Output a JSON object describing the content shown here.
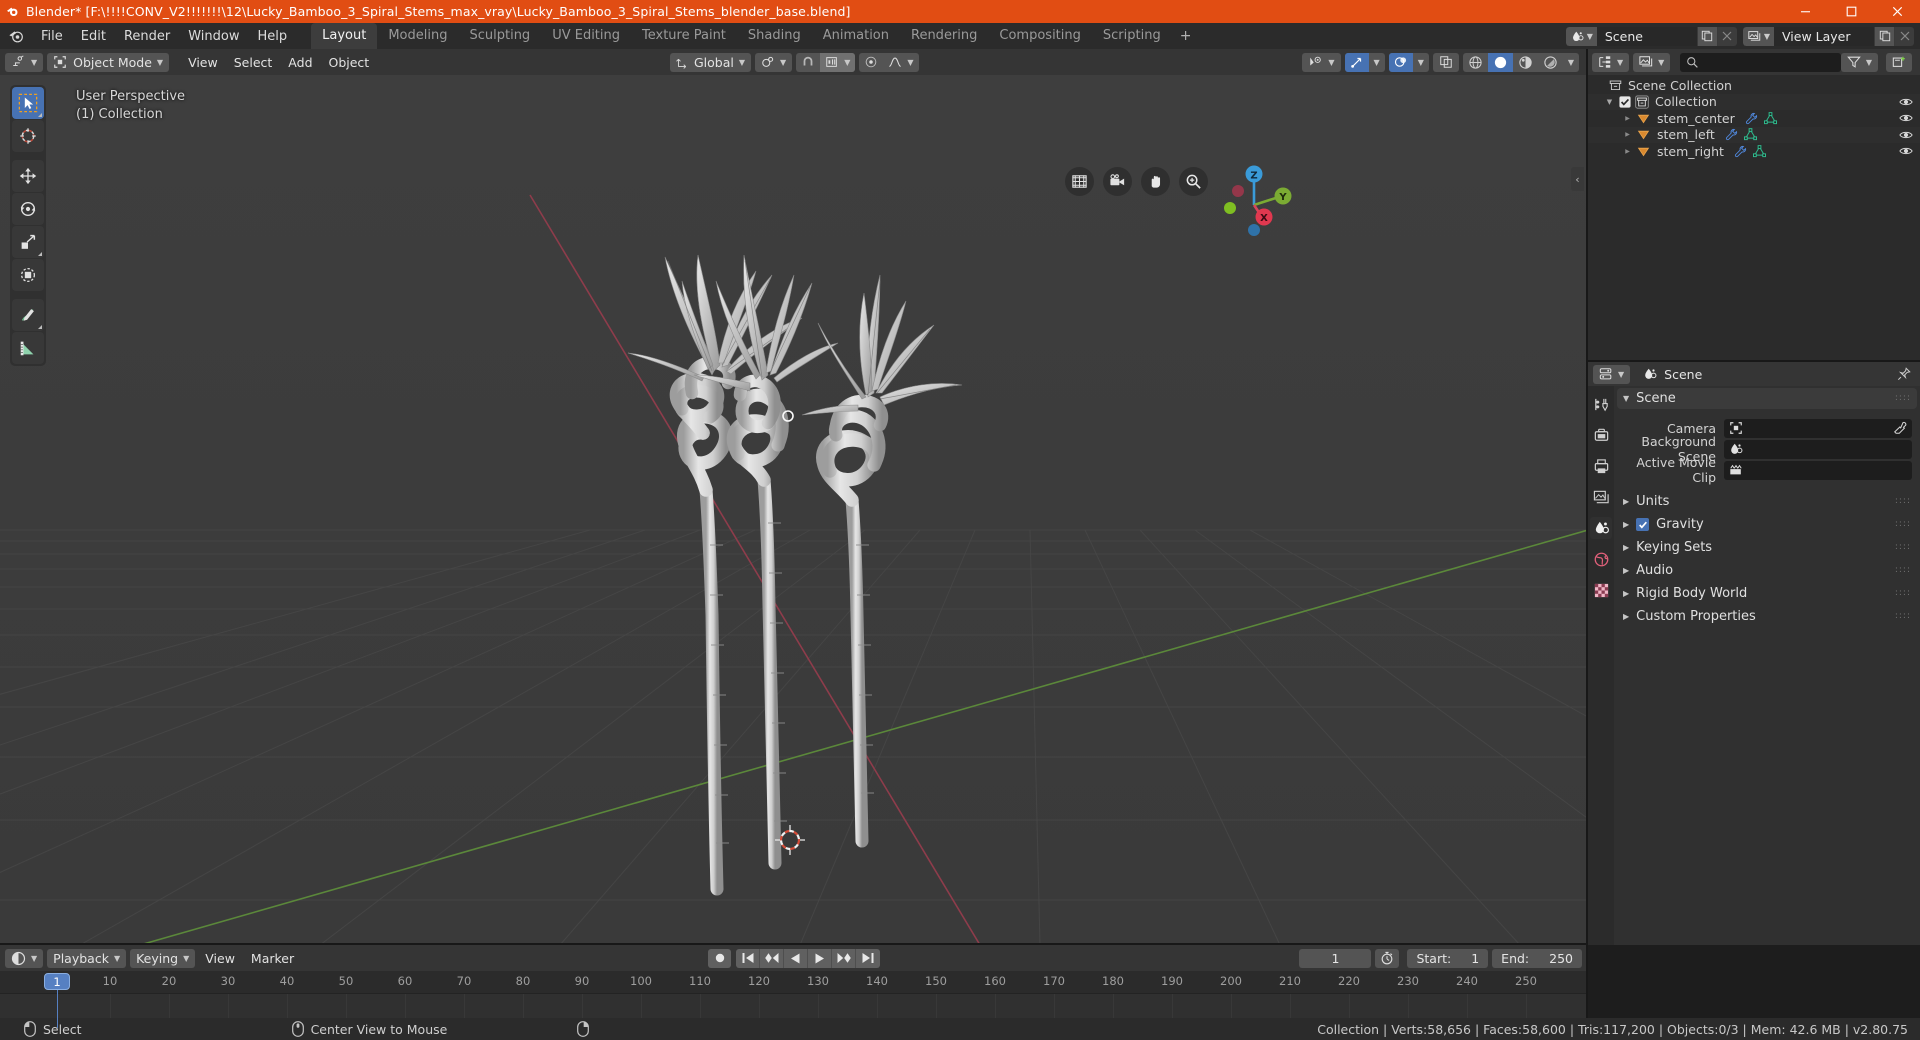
{
  "window": {
    "title": "Blender* [F:\\!!!!CONV_V2!!!!!!!\\12\\Lucky_Bamboo_3_Spiral_Stems_max_vray\\Lucky_Bamboo_3_Spiral_Stems_blender_base.blend]",
    "app_icon": "blender-logo-icon",
    "minimize": "–",
    "maximize": "□",
    "close": "✕",
    "accent_color": "#e14d13"
  },
  "topbar": {
    "menus": [
      "File",
      "Edit",
      "Render",
      "Window",
      "Help"
    ],
    "workspaces": [
      {
        "label": "Layout",
        "active": true
      },
      {
        "label": "Modeling",
        "active": false
      },
      {
        "label": "Sculpting",
        "active": false
      },
      {
        "label": "UV Editing",
        "active": false
      },
      {
        "label": "Texture Paint",
        "active": false
      },
      {
        "label": "Shading",
        "active": false
      },
      {
        "label": "Animation",
        "active": false
      },
      {
        "label": "Rendering",
        "active": false
      },
      {
        "label": "Compositing",
        "active": false
      },
      {
        "label": "Scripting",
        "active": false
      }
    ],
    "add_workspace": "+",
    "scene_name": "Scene",
    "view_layer_name": "View Layer"
  },
  "viewport_header": {
    "editor_type_icon": "editor-type-icon",
    "mode": "Object Mode",
    "menus": [
      "View",
      "Select",
      "Add",
      "Object"
    ],
    "transform_orientation": "Global",
    "pivot_icon": "pivot-point-icon",
    "snap_icon": "magnet-icon",
    "snap_target_icon": "snap-increment-icon",
    "proportional_icon": "proportional-edit-icon",
    "falloff_icon": "smooth-falloff-icon",
    "visibility_icon": "visibility-selector-icon",
    "gizmo_icon": "gizmo-icon",
    "overlays_icon": "overlays-icon",
    "xray_icon": "xray-toggle-icon",
    "shading_modes": [
      "wireframe",
      "solid",
      "material-preview",
      "rendered"
    ],
    "active_shading": "solid"
  },
  "viewport": {
    "perspective_label": "User Perspective",
    "collection_label": "(1) Collection",
    "tools": [
      {
        "name": "tweak-tool",
        "active": true
      },
      {
        "name": "cursor-tool",
        "active": false
      },
      {
        "name": "move-tool",
        "active": false
      },
      {
        "name": "rotate-tool",
        "active": false
      },
      {
        "name": "scale-tool",
        "active": false
      },
      {
        "name": "transform-tool",
        "active": false
      },
      {
        "name": "annotate-tool",
        "active": false
      },
      {
        "name": "measure-tool",
        "active": false
      }
    ],
    "nav_buttons": [
      "grid-view-icon",
      "camera-view-icon",
      "pan-view-icon",
      "zoom-view-icon"
    ],
    "gizmo_axes": [
      "Z",
      "Y",
      "X"
    ],
    "collapse_arrow": "‹"
  },
  "outliner": {
    "display_mode_icon": "outliner-display-icon",
    "filter_id_icon": "view-layer-icon",
    "search_icon": "search-icon",
    "search_placeholder": "",
    "filter_icon": "filter-funnel-icon",
    "new_collection_icon": "new-collection-icon",
    "rows": [
      {
        "label": "Scene Collection",
        "indent": 0,
        "icon": "collection-icon",
        "type": "scene-collection",
        "disclose": "",
        "checkbox": false,
        "eye": false
      },
      {
        "label": "Collection",
        "indent": 1,
        "icon": "collection-icon",
        "type": "collection",
        "disclose": "▼",
        "checkbox": true,
        "eye": true
      },
      {
        "label": "stem_center",
        "indent": 2,
        "icon": "mesh-object-icon",
        "type": "object",
        "disclose": "▶",
        "checkbox": false,
        "eye": true
      },
      {
        "label": "stem_left",
        "indent": 2,
        "icon": "mesh-object-icon",
        "type": "object",
        "disclose": "▶",
        "checkbox": false,
        "eye": true
      },
      {
        "label": "stem_right",
        "indent": 2,
        "icon": "mesh-object-icon",
        "type": "object",
        "disclose": "▶",
        "checkbox": false,
        "eye": true
      }
    ]
  },
  "properties": {
    "editor_icon": "properties-editor-icon",
    "breadcrumb_icon": "scene-icon",
    "breadcrumb": "Scene",
    "pin_icon": "pin-icon",
    "tabs": [
      {
        "name": "tool-tab",
        "icon": "tool-icon",
        "active": false
      },
      {
        "name": "render-tab",
        "icon": "render-icon",
        "active": false
      },
      {
        "name": "output-tab",
        "icon": "printer-icon",
        "active": false
      },
      {
        "name": "view-layer-tab",
        "icon": "view-layer-icon",
        "active": false
      },
      {
        "name": "scene-tab",
        "icon": "scene-icon",
        "active": true
      },
      {
        "name": "world-tab",
        "icon": "world-icon",
        "active": false
      },
      {
        "name": "texture-tab",
        "icon": "texture-checker-icon",
        "active": false
      }
    ],
    "panel_title": "Scene",
    "fields": [
      {
        "label": "Camera",
        "value": "",
        "icon": "camera-data-icon",
        "has_picker": true
      },
      {
        "label": "Background Scene",
        "value": "",
        "icon": "scene-icon",
        "has_picker": false
      },
      {
        "label": "Active Movie Clip",
        "value": "",
        "icon": "movie-clip-icon",
        "has_picker": false
      }
    ],
    "sections": [
      {
        "label": "Units",
        "checkbox": null
      },
      {
        "label": "Gravity",
        "checkbox": true
      },
      {
        "label": "Keying Sets",
        "checkbox": null
      },
      {
        "label": "Audio",
        "checkbox": null
      },
      {
        "label": "Rigid Body World",
        "checkbox": null
      },
      {
        "label": "Custom Properties",
        "checkbox": null
      }
    ]
  },
  "timeline": {
    "editor_icon": "timeline-editor-icon",
    "menus": [
      "Playback",
      "Keying",
      "View",
      "Marker"
    ],
    "playback_buttons": [
      "record-icon",
      "jump-start-icon",
      "prev-keyframe-icon",
      "play-reverse-icon",
      "play-icon",
      "next-keyframe-icon",
      "jump-end-icon"
    ],
    "current_frame": "1",
    "use_preview_icon": "stopwatch-icon",
    "start_label": "Start:",
    "start_value": "1",
    "end_label": "End:",
    "end_value": "250",
    "ruler_ticks": [
      1,
      10,
      20,
      30,
      40,
      50,
      60,
      70,
      80,
      90,
      100,
      110,
      120,
      130,
      140,
      150,
      160,
      170,
      180,
      190,
      200,
      210,
      220,
      230,
      240,
      250
    ],
    "playhead_frame": "1"
  },
  "statusbar": {
    "mouse_hints": [
      {
        "icon": "mouse-left-icon",
        "label": "Select"
      },
      {
        "icon": "mouse-middle-icon",
        "label": "Center View to Mouse"
      },
      {
        "icon": "mouse-right-icon",
        "label": ""
      }
    ],
    "stats": "Collection | Verts:58,656 | Faces:58,600 | Tris:117,200 | Objects:0/3 | Mem: 42.6 MB | v2.80.75"
  }
}
